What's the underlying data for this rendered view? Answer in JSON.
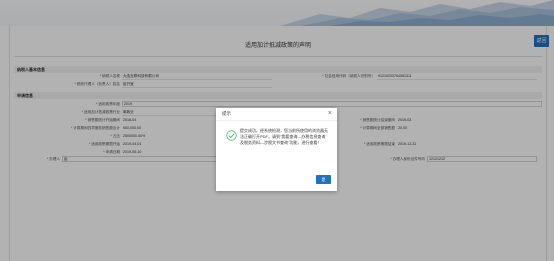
{
  "header": {
    "back_label": "返回"
  },
  "page": {
    "title": "适用加计抵减政策的声明"
  },
  "section_taxpayer": {
    "title": "纳税人基本信息",
    "name_label": "* 纳税人名称",
    "name_value": "大连互联科技有限公司",
    "id_label": "* 社会信用代码（纳税人识别号）",
    "id_value": "91210203764081311",
    "contact_label": "* 税收代理人（负责人）姓名",
    "contact_value": "赵开宝"
  },
  "section_apply": {
    "title": "申请信息",
    "rows": [
      {
        "label": "* 适用政策年度",
        "value": "2019"
      },
      {
        "label": "* 适用加计抵减政策行业",
        "value": "邮政业"
      },
      {
        "label": "* 销售额统计开始期间",
        "value": "2018-04",
        "right_label": "* 销售额统计结束期间",
        "right_value": "2019-03"
      },
      {
        "label": "* 计算期间四项服务销售额合计",
        "value": "500,000.00",
        "right_label": "* 计算期间全部销售额",
        "right_value": "20.00"
      },
      {
        "label": "* 占比",
        "value": "2500000.00%"
      },
      {
        "label": "* 适用政策期限开始",
        "value": "2019-04-01",
        "right_label": "* 适用政策期限结束",
        "right_value": "2019-12-31"
      },
      {
        "label": "* 申请日期",
        "value": "2019-05-10"
      }
    ],
    "agent_label": "* 办理人",
    "agent_value": "赵",
    "agent_id_label": "* 办理人身份证件号码",
    "agent_id_value": "12121212"
  },
  "dialog": {
    "title": "提示",
    "close_glyph": "×",
    "message": "提交成功。经系统检测，您当前所使用的浏览器无法正确打开PDF，请到\"我要查询—办税信息查询及税务资料—涉税文书查询\"功能，进行查看！",
    "ok_label": "是"
  },
  "colors": {
    "accent": "#1e73be",
    "success": "#3cb878"
  },
  "icons": {
    "dialog_icon": "success-check-icon",
    "close_icon": "close-icon"
  }
}
